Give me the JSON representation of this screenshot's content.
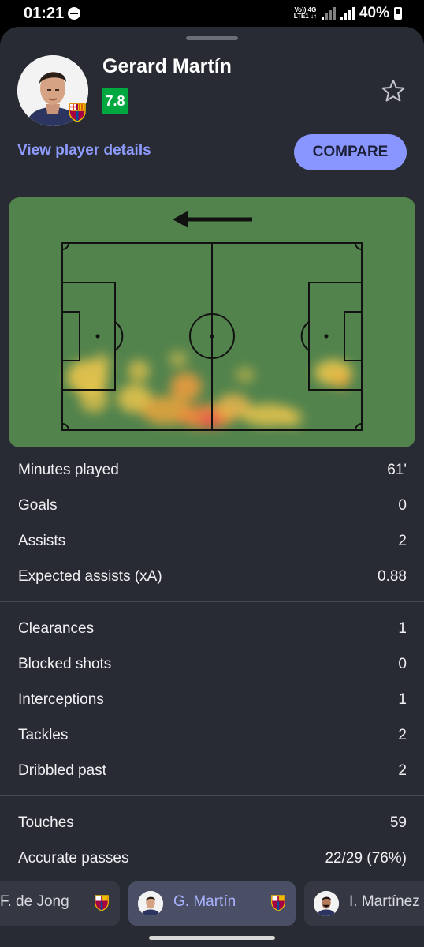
{
  "status_bar": {
    "time": "01:21",
    "network_top": "Vo)) 4G",
    "network_bottom": "LTE1 ↓↑",
    "battery": "40%"
  },
  "player": {
    "name": "Gerard Martín",
    "rating": "7.8",
    "rating_color": "#00a83f",
    "view_details_label": "View player details",
    "compare_label": "COMPARE"
  },
  "heatmap": {
    "attack_direction": "left",
    "pitch_color": "#52834d"
  },
  "stats_groups": [
    [
      {
        "label": "Minutes played",
        "value": "61'"
      },
      {
        "label": "Goals",
        "value": "0"
      },
      {
        "label": "Assists",
        "value": "2"
      },
      {
        "label": "Expected assists (xA)",
        "value": "0.88"
      }
    ],
    [
      {
        "label": "Clearances",
        "value": "1"
      },
      {
        "label": "Blocked shots",
        "value": "0"
      },
      {
        "label": "Interceptions",
        "value": "1"
      },
      {
        "label": "Tackles",
        "value": "2"
      },
      {
        "label": "Dribbled past",
        "value": "2"
      }
    ],
    [
      {
        "label": "Touches",
        "value": "59"
      },
      {
        "label": "Accurate passes",
        "value": "22/29 (76%)"
      }
    ]
  ],
  "player_tabs": [
    {
      "name": "F. de Jong",
      "active": false
    },
    {
      "name": "G. Martín",
      "active": true
    },
    {
      "name": "I. Martínez",
      "active": false
    }
  ],
  "colors": {
    "accent": "#8a96ff",
    "link": "#8f9cff",
    "sheet_bg": "#282b33"
  }
}
